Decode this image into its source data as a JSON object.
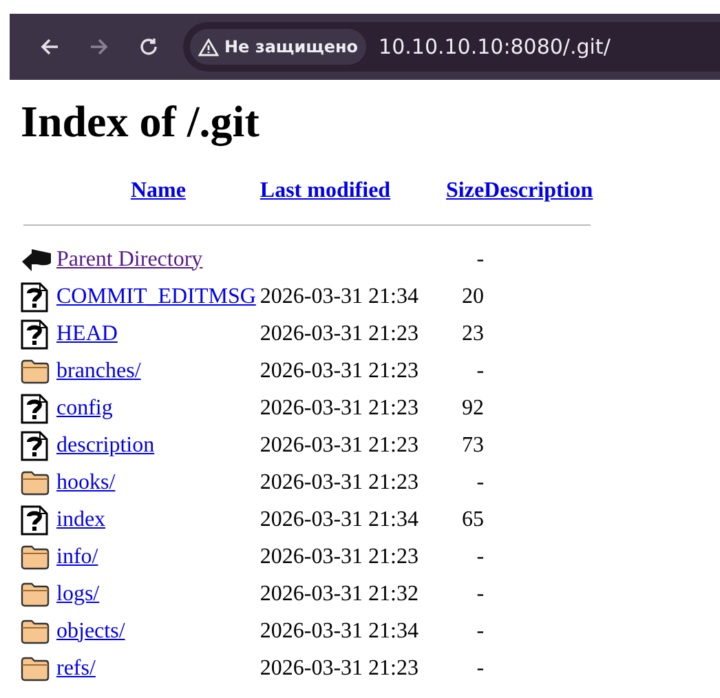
{
  "browser": {
    "security_label": "Не защищено",
    "address": "10.10.10.10:8080/.git/"
  },
  "page": {
    "heading": "Index of /.git",
    "columns": [
      "Name",
      "Last modified",
      "Size",
      "Description"
    ],
    "rows": [
      {
        "kind": "parent",
        "name": "Parent Directory",
        "modified": "",
        "size": "-",
        "visited": true
      },
      {
        "kind": "file",
        "name": "COMMIT_EDITMSG",
        "modified": "2026-03-31 21:34",
        "size": "20",
        "visited": false
      },
      {
        "kind": "file",
        "name": "HEAD",
        "modified": "2026-03-31 21:23",
        "size": "23",
        "visited": false
      },
      {
        "kind": "folder",
        "name": "branches/",
        "modified": "2026-03-31 21:23",
        "size": "-",
        "visited": false
      },
      {
        "kind": "file",
        "name": "config",
        "modified": "2026-03-31 21:23",
        "size": "92",
        "visited": false
      },
      {
        "kind": "file",
        "name": "description",
        "modified": "2026-03-31 21:23",
        "size": "73",
        "visited": false
      },
      {
        "kind": "folder",
        "name": "hooks/",
        "modified": "2026-03-31 21:23",
        "size": "-",
        "visited": false
      },
      {
        "kind": "file",
        "name": "index",
        "modified": "2026-03-31 21:34",
        "size": "65",
        "visited": false
      },
      {
        "kind": "folder",
        "name": "info/",
        "modified": "2026-03-31 21:23",
        "size": "-",
        "visited": false
      },
      {
        "kind": "folder",
        "name": "logs/",
        "modified": "2026-03-31 21:32",
        "size": "-",
        "visited": false
      },
      {
        "kind": "folder",
        "name": "objects/",
        "modified": "2026-03-31 21:34",
        "size": "-",
        "visited": false
      },
      {
        "kind": "folder",
        "name": "refs/",
        "modified": "2026-03-31 21:23",
        "size": "-",
        "visited": false
      }
    ]
  }
}
